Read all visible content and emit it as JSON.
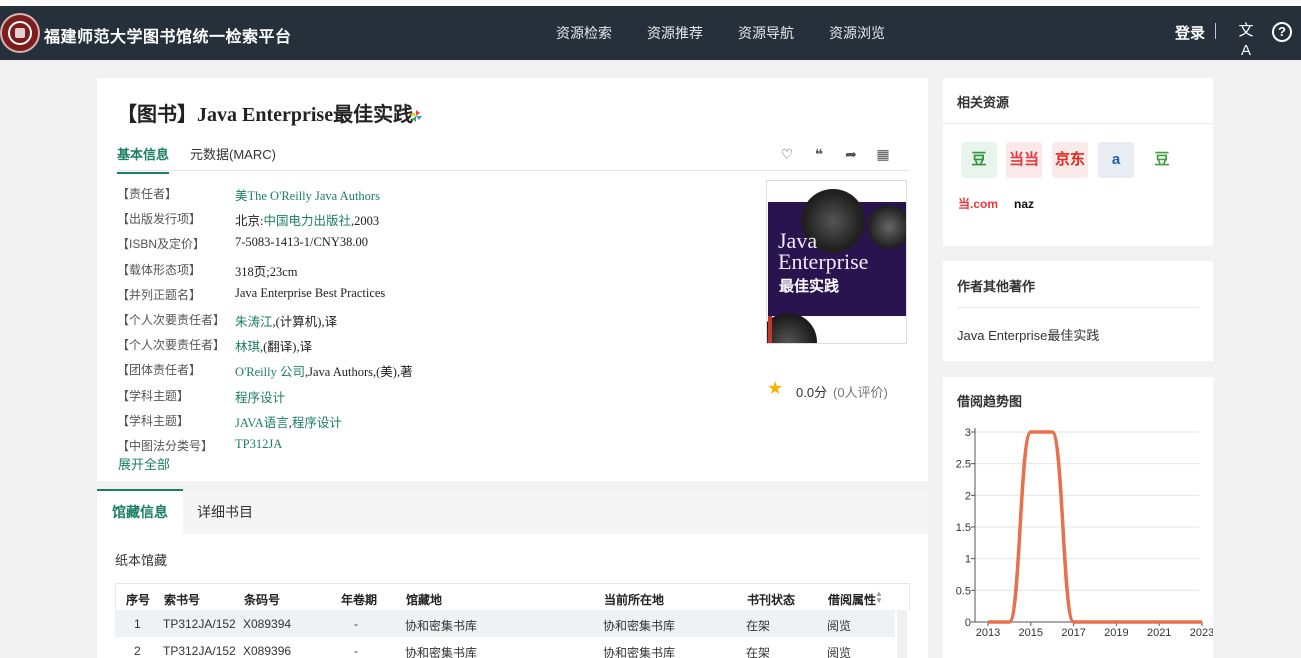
{
  "header": {
    "site_title": "福建师范大学图书馆统一检索平台",
    "nav": [
      "资源检索",
      "资源推荐",
      "资源导航",
      "资源浏览"
    ],
    "login": "登录",
    "lang_icon": "文A",
    "help_icon": "?"
  },
  "book": {
    "title": "【图书】Java Enterprise最佳实践",
    "tabs": {
      "basic": "基本信息",
      "marc": "元数据(MARC)"
    },
    "actions": [
      "favorite-icon",
      "quote-icon",
      "share-icon",
      "qrcode-icon"
    ],
    "fields": [
      {
        "label": "【责任者】",
        "parts": [
          {
            "t": "美The O'Reilly Java Authors",
            "link": true
          }
        ]
      },
      {
        "label": "【出版发行项】",
        "parts": [
          {
            "t": "北京:",
            "link": false
          },
          {
            "t": "中国电力出版社",
            "link": true
          },
          {
            "t": ",2003",
            "link": false
          }
        ]
      },
      {
        "label": "【ISBN及定价】",
        "parts": [
          {
            "t": "7-5083-1413-1/CNY38.00",
            "link": false
          }
        ]
      },
      {
        "label": "【载体形态项】",
        "parts": [
          {
            "t": "318页;23cm",
            "link": false
          }
        ]
      },
      {
        "label": "【并列正题名】",
        "parts": [
          {
            "t": "Java Enterprise Best Practices",
            "link": false
          }
        ]
      },
      {
        "label": "【个人次要责任者】",
        "parts": [
          {
            "t": "朱涛江",
            "link": true
          },
          {
            "t": ",(计算机),译",
            "link": false
          }
        ]
      },
      {
        "label": "【个人次要责任者】",
        "parts": [
          {
            "t": "林琪",
            "link": true
          },
          {
            "t": ",(翻译),译",
            "link": false
          }
        ]
      },
      {
        "label": "【团体责任者】",
        "parts": [
          {
            "t": "O'Reilly 公司",
            "link": true
          },
          {
            "t": ",Java Authors,(美),著",
            "link": false
          }
        ]
      },
      {
        "label": "【学科主题】",
        "parts": [
          {
            "t": "程序设计",
            "link": true
          }
        ]
      },
      {
        "label": "【学科主题】",
        "parts": [
          {
            "t": "JAVA语言",
            "link": true
          },
          {
            "t": ",",
            "link": false
          },
          {
            "t": "程序设计",
            "link": true
          }
        ]
      },
      {
        "label": "【中图法分类号】",
        "parts": [
          {
            "t": "TP312JA",
            "link": true
          }
        ]
      }
    ],
    "expand_all": "展开全部",
    "cover": {
      "line1": "Java",
      "line2": "Enterprise",
      "line3": "最佳实践"
    },
    "rating": {
      "score": "0.0分",
      "count": "(0人评价)"
    }
  },
  "holdings": {
    "tabs": {
      "active": "馆藏信息",
      "other": "详细书目"
    },
    "paper_title": "纸本馆藏",
    "columns": [
      "序号",
      "索书号",
      "条码号",
      "年卷期",
      "馆藏地",
      "当前所在地",
      "书刊状态",
      "借阅属性"
    ],
    "rows": [
      [
        "1",
        "TP312JA/152",
        "X089394",
        "-",
        "协和密集书库",
        "协和密集书库",
        "在架",
        "阅览"
      ],
      [
        "2",
        "TP312JA/152",
        "X089396",
        "-",
        "协和密集书库",
        "协和密集书库",
        "在架",
        "阅览"
      ]
    ]
  },
  "related": {
    "title": "相关资源",
    "icons": [
      {
        "name": "douban-icon",
        "glyph": "豆",
        "color": "#2e963d",
        "bg": "#e9f4ec"
      },
      {
        "name": "dangdang-icon",
        "glyph": "当当",
        "color": "#e4393c",
        "bg": "#fbe9e9"
      },
      {
        "name": "jd-icon",
        "glyph": "京东",
        "color": "#e1251b",
        "bg": "#fbeaea"
      },
      {
        "name": "amazon-icon",
        "glyph": "a",
        "color": "#1f5fa6",
        "bg": "#e9eef5"
      },
      {
        "name": "douban-read-icon",
        "glyph": "豆",
        "color": "#43a047",
        "bg": "#ffffff"
      },
      {
        "name": "dangdang-com-icon",
        "glyph": "当.com",
        "color": "#e4393c",
        "bg": "#ffffff"
      },
      {
        "name": "amazon-cn-icon",
        "glyph": "naz",
        "color": "#111111",
        "bg": "#ffffff"
      }
    ]
  },
  "other_works": {
    "title": "作者其他著作",
    "items": [
      "Java Enterprise最佳实践"
    ]
  },
  "trend": {
    "title": "借阅趋势图"
  },
  "chart_data": {
    "type": "line",
    "x": [
      2013,
      2014,
      2015,
      2016,
      2017,
      2018,
      2019,
      2020,
      2021,
      2022,
      2023
    ],
    "series": [
      {
        "values": [
          0,
          0,
          3,
          3,
          0,
          0,
          0,
          0,
          0,
          0,
          0
        ]
      }
    ],
    "x_ticks": [
      "2013",
      "2015",
      "2017",
      "2019",
      "2021",
      "2023"
    ],
    "y_ticks": [
      "0",
      "0.5",
      "1",
      "1.5",
      "2",
      "2.5",
      "3"
    ],
    "ylim": [
      0,
      3
    ],
    "xlim": [
      2013,
      2023
    ],
    "grid": true,
    "color": "#e8704c"
  }
}
